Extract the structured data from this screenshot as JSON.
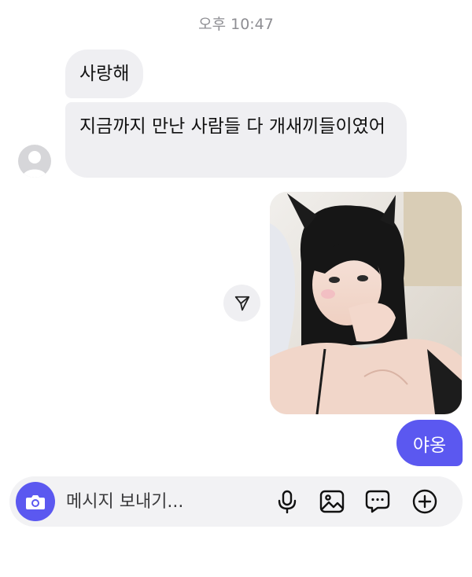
{
  "timestamp": "오후 10:47",
  "messages": {
    "incoming": [
      {
        "text": "사랑해"
      },
      {
        "text": "지금까지 만난 사람들 다 개새끼들이였어"
      }
    ],
    "outgoing": [
      {
        "text": "야옹"
      }
    ]
  },
  "composer": {
    "placeholder": "메시지 보내기..."
  },
  "icons": {
    "avatar": "avatar-placeholder-icon",
    "share": "send-arrow-icon",
    "camera": "camera-icon",
    "mic": "microphone-icon",
    "gallery": "gallery-icon",
    "chat": "chat-bubble-icon",
    "plus": "plus-circle-icon"
  },
  "colors": {
    "accent": "#5b58f0",
    "bubble_incoming": "#efeff2",
    "background": "#ffffff"
  }
}
